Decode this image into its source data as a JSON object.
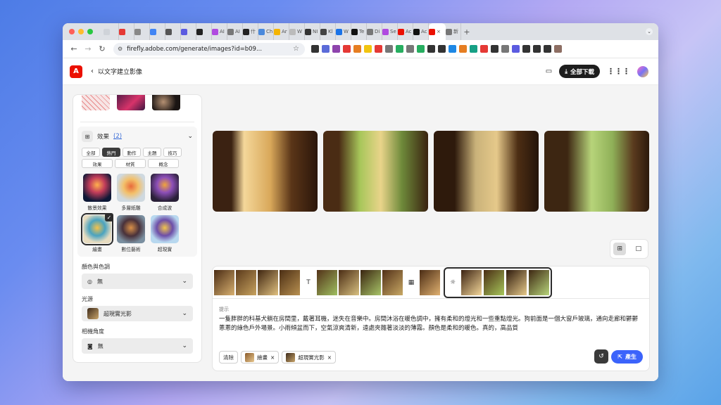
{
  "browser": {
    "tabs": [
      {
        "label": "",
        "color": "#cfd3d9"
      },
      {
        "label": "",
        "color": "#e53935"
      },
      {
        "label": "",
        "color": "#888888"
      },
      {
        "label": "",
        "color": "#4285f4"
      },
      {
        "label": "",
        "color": "#555555"
      },
      {
        "label": "",
        "color": "#5b5be0"
      },
      {
        "label": "",
        "color": "#222222"
      },
      {
        "label": "AI",
        "color": "#b04ae0"
      },
      {
        "label": "AI",
        "color": "#777777"
      },
      {
        "label": "什",
        "color": "#222222"
      },
      {
        "label": "Ch",
        "color": "#4a89dc"
      },
      {
        "label": "Ar",
        "color": "#f4b400"
      },
      {
        "label": "W",
        "color": "#bbbbbb"
      },
      {
        "label": "NI",
        "color": "#333333"
      },
      {
        "label": "Kl",
        "color": "#444444"
      },
      {
        "label": "W",
        "color": "#1a73e8"
      },
      {
        "label": "Te",
        "color": "#111111"
      },
      {
        "label": "Di",
        "color": "#777777"
      },
      {
        "label": "Se",
        "color": "#b04ae0"
      },
      {
        "label": "Ac",
        "color": "#eb1000"
      },
      {
        "label": "Ac",
        "color": "#111111"
      },
      {
        "label": "×",
        "color": "#eb1000"
      },
      {
        "label": "新",
        "color": "#777777"
      }
    ],
    "active_tab": 21,
    "url": "firefly.adobe.com/generate/images?id=b09...",
    "extension_colors": [
      "#333333",
      "#5b6bd8",
      "#8e44ad",
      "#e53935",
      "#e67e22",
      "#f1c40f",
      "#e53935",
      "#777777",
      "#27ae60",
      "#777777",
      "#27ae60",
      "#333333",
      "#333333",
      "#1e88e5",
      "#e67e22",
      "#16a085",
      "#e53935",
      "#333333",
      "#777777",
      "#5b5be0",
      "#333333",
      "#333333",
      "#333333",
      "#8d6e63"
    ]
  },
  "app": {
    "title": "以文字建立影像",
    "download_all": "全部下載"
  },
  "panel": {
    "effects": {
      "title": "效果",
      "count": "(2)",
      "filters": [
        "全部",
        "熱門",
        "動作",
        "主題",
        "技巧",
        "效果",
        "材質",
        "概念"
      ],
      "active_filter": "熱門",
      "items": [
        {
          "label": "散景效果",
          "selected": false
        },
        {
          "label": "多層紙雕",
          "selected": false
        },
        {
          "label": "合成波",
          "selected": false
        },
        {
          "label": "繪畫",
          "selected": true
        },
        {
          "label": "數位藝術",
          "selected": false
        },
        {
          "label": "超現實",
          "selected": false
        }
      ]
    },
    "color_tone": {
      "label": "顏色與色調",
      "value": "無"
    },
    "lighting": {
      "label": "光源",
      "value": "超現實光影"
    },
    "camera_angle": {
      "label": "相機角度",
      "value": "無"
    }
  },
  "prompt": {
    "label": "提示",
    "text": "一隻胖胖的科基犬躺在房間里，戴著耳機，迷失在音樂中。房間沐浴在暖色調中，擁有柔和的燈光和一些重點燈光。狗前面是一個大窗戶玻璃，通向走廊和鬱鬱蔥蔥的綠色戶外場景。小雨傾盆而下，空氣涼爽清新，遠處夾雜著淡淡的薄霧。顏色是柔和的暖色。真的，高品質",
    "clear": "清除",
    "tags": [
      "繪畫",
      "超現實光影"
    ],
    "generate": "產生"
  }
}
